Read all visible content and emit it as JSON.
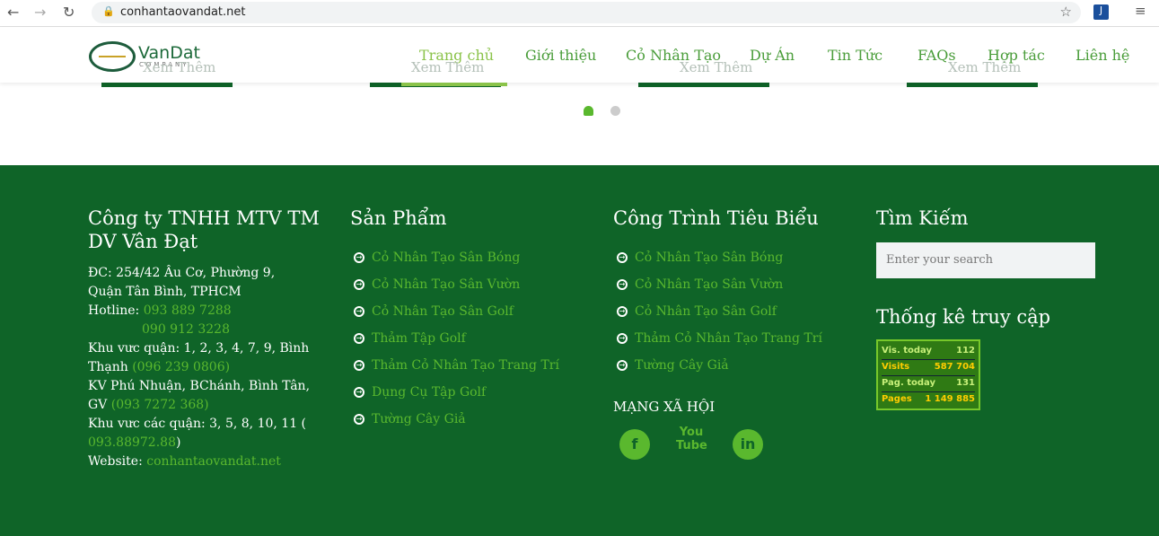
{
  "browser": {
    "url": "conhantaovandat.net"
  },
  "slider": {
    "button_label": "Xem Thêm"
  },
  "header": {
    "logo_name": "VanDat",
    "logo_sub": "COMPANY",
    "nav": [
      "Trang chủ",
      "Giới thiệu",
      "Cỏ Nhân Tạo",
      "Dự Án",
      "Tin Tức",
      "FAQs",
      "Hợp tác",
      "Liên hệ"
    ]
  },
  "footer": {
    "company": {
      "title": "Công ty TNHH MTV TM DV Vân Đạt",
      "address": "ĐC: 254/42 Âu Cơ, Phường 9, Quận Tân Bình, TPHCM",
      "hotline_label": "Hotline: ",
      "hotline1": "093 889 7288",
      "hotline2": "090 912 3228",
      "area1": "Khu vưc quận: 1, 2, 3, 4, 7, 9, Bình Thạnh ",
      "area1_phone": "(096 239 0806)",
      "area2": "KV Phú Nhuận, BChánh, Bình Tân, GV ",
      "area2_phone": "(093 7272 368)",
      "area3": "Khu vưc các quận: 3, 5, 8, 10, 11 ( ",
      "area3_phone": "093.88972.88",
      "area3_end": ")",
      "website_label": "Website: ",
      "website": "conhantaovandat.net"
    },
    "products": {
      "title": "Sản Phẩm",
      "items": [
        "Cỏ Nhân Tạo Sân Bóng",
        "Cỏ Nhân Tạo Sân Vườn",
        "Cỏ Nhân Tạo Sân Golf",
        "Thảm Tập Golf",
        "Thảm Cỏ Nhân Tạo Trang Trí",
        "Dụng Cụ Tập Golf",
        "Tường Cây Giả"
      ]
    },
    "projects": {
      "title": "Công Trình Tiêu Biểu",
      "items": [
        "Cỏ Nhân Tạo Sân Bóng",
        "Cỏ Nhân Tạo Sân Vườn",
        "Cỏ Nhân Tạo Sân Golf",
        "Thảm Cỏ Nhân Tạo Trang Trí",
        "Tường Cây Giả"
      ]
    },
    "social": {
      "title": "MẠNG XÃ HỘI",
      "icons": [
        "facebook-icon",
        "youtube-icon",
        "linkedin-icon"
      ],
      "youtube_text": "You Tube"
    },
    "search": {
      "title": "Tìm Kiếm",
      "placeholder": "Enter your search"
    },
    "stats": {
      "title": "Thống kê truy cập",
      "rows": [
        {
          "label": "Vis. today",
          "value": "112",
          "color": "#c8f07a"
        },
        {
          "label": "Visits",
          "value": "587 704",
          "color": "#ffcc00"
        },
        {
          "label": "Pag. today",
          "value": "131",
          "color": "#c8f07a"
        },
        {
          "label": "Pages",
          "value": "1 149 885",
          "color": "#ffcc00"
        }
      ]
    }
  }
}
